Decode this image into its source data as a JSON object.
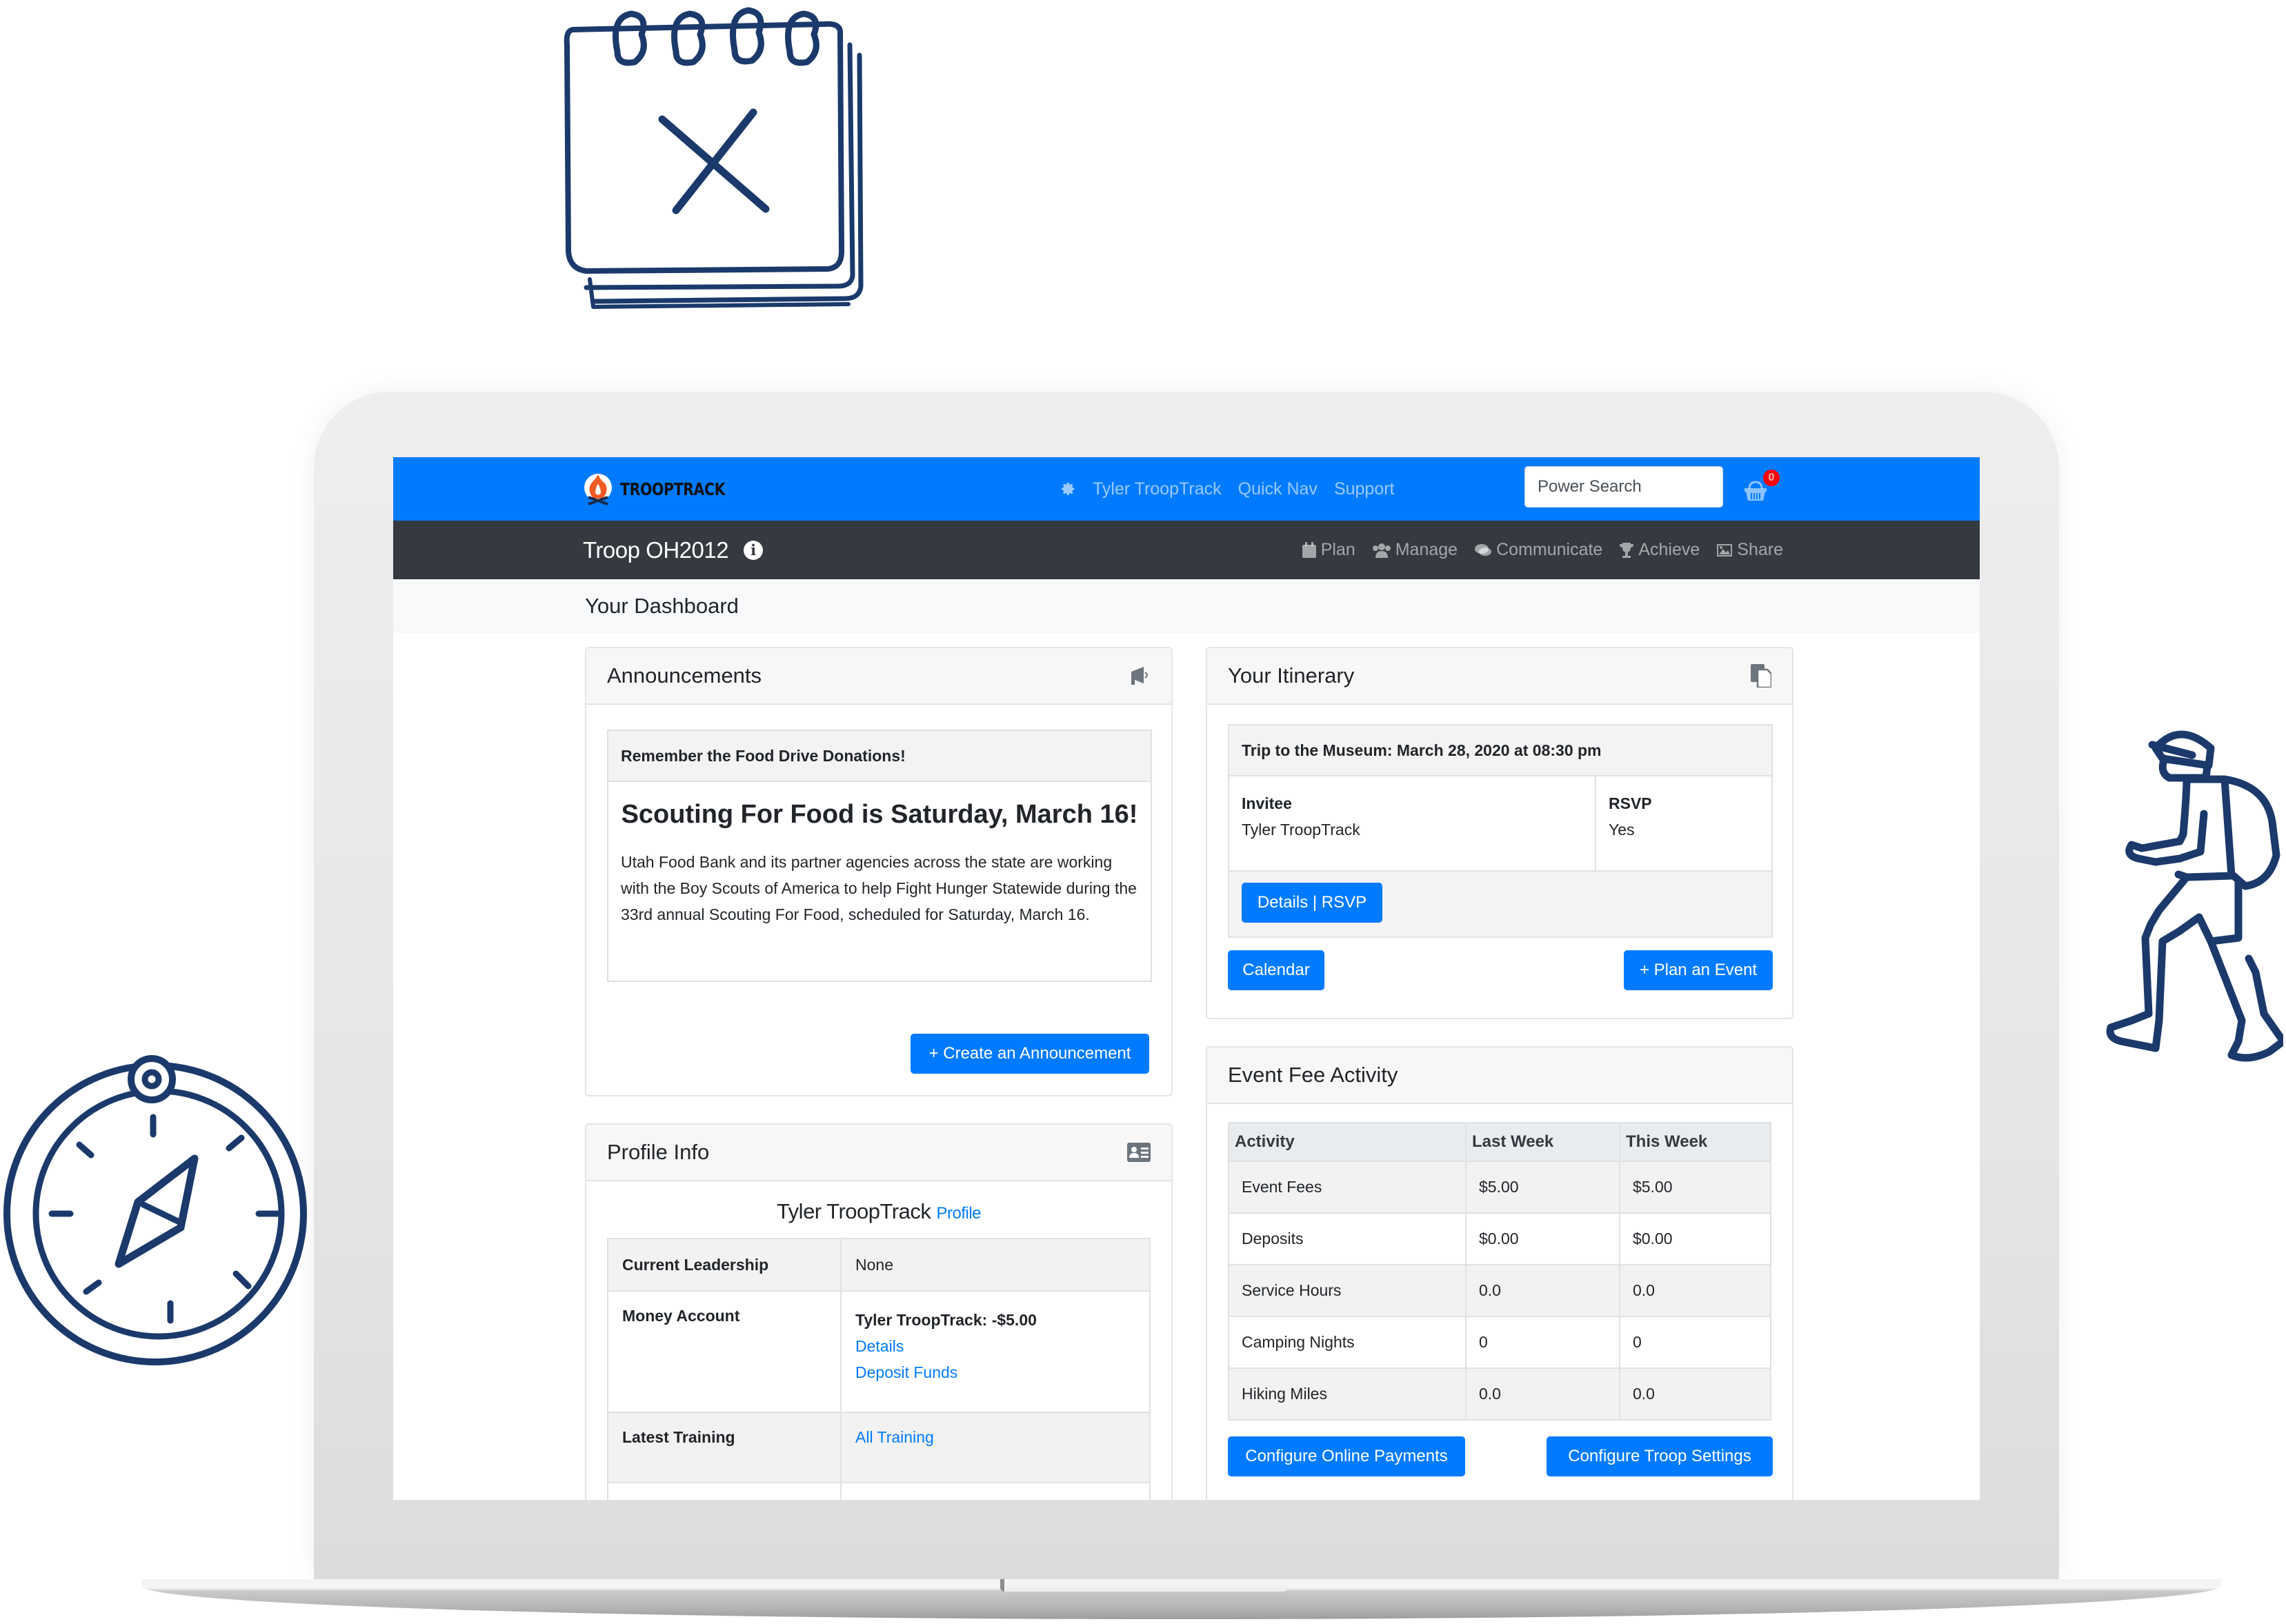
{
  "app": {
    "brand": "TROOPTRACK",
    "top_nav": {
      "settings_icon": "gear-icon",
      "user_link": "Tyler TroopTrack",
      "quick_nav": "Quick Nav",
      "support": "Support",
      "search_placeholder": "Power Search",
      "cart_icon": "basket-icon",
      "cart_count": "0"
    },
    "troop_name": "Troop OH2012",
    "troop_info_icon": "info-icon",
    "sub_nav": [
      {
        "label": "Plan",
        "icon": "calendar-icon"
      },
      {
        "label": "Manage",
        "icon": "users-icon"
      },
      {
        "label": "Communicate",
        "icon": "comments-icon"
      },
      {
        "label": "Achieve",
        "icon": "trophy-icon"
      },
      {
        "label": "Share",
        "icon": "image-icon"
      }
    ],
    "page_title": "Your Dashboard"
  },
  "announcements": {
    "title": "Announcements",
    "icon": "bullhorn-icon",
    "item": {
      "header": "Remember the Food Drive Donations!",
      "headline": "Scouting For Food is Saturday, March 16!",
      "body": "Utah Food Bank and its partner agencies across the state are working with the Boy Scouts of America to help Fight Hunger Statewide during the 33rd annual Scouting For Food, scheduled for Saturday, March 16."
    },
    "create_button": "+ Create an Announcement"
  },
  "itinerary": {
    "title": "Your Itinerary",
    "icon": "copy-icon",
    "event": {
      "header": "Trip to the Museum: March 28, 2020 at 08:30 pm",
      "invitee_label": "Invitee",
      "invitee_value": "Tyler TroopTrack",
      "rsvp_label": "RSVP",
      "rsvp_value": "Yes",
      "details_button": "Details | RSVP"
    },
    "calendar_button": "Calendar",
    "plan_button": "+ Plan an Event"
  },
  "profile": {
    "title": "Profile Info",
    "icon": "id-card-icon",
    "name": "Tyler TroopTrack",
    "profile_link": "Profile",
    "rows": [
      {
        "label": "Current Leadership",
        "value": "None"
      },
      {
        "label": "Money Account",
        "value": "Tyler TroopTrack: -$5.00",
        "links": [
          "Details",
          "Deposit Funds"
        ]
      },
      {
        "label": "Latest Training",
        "links": [
          "All Training"
        ]
      }
    ]
  },
  "event_fees": {
    "title": "Event Fee Activity",
    "columns": [
      "Activity",
      "Last Week",
      "This Week"
    ],
    "rows": [
      [
        "Event Fees",
        "$5.00",
        "$5.00"
      ],
      [
        "Deposits",
        "$0.00",
        "$0.00"
      ],
      [
        "Service Hours",
        "0.0",
        "0.0"
      ],
      [
        "Camping Nights",
        "0",
        "0"
      ],
      [
        "Hiking Miles",
        "0.0",
        "0.0"
      ]
    ],
    "payments_button": "Configure Online Payments",
    "settings_button": "Configure Troop Settings"
  },
  "colors": {
    "primary": "#007bff",
    "dark_nav": "#343a40",
    "badge": "#ff0000",
    "illustration": "#1b3a6b"
  },
  "decorations": [
    "calendar-x-illustration",
    "compass-illustration",
    "hiker-illustration"
  ]
}
